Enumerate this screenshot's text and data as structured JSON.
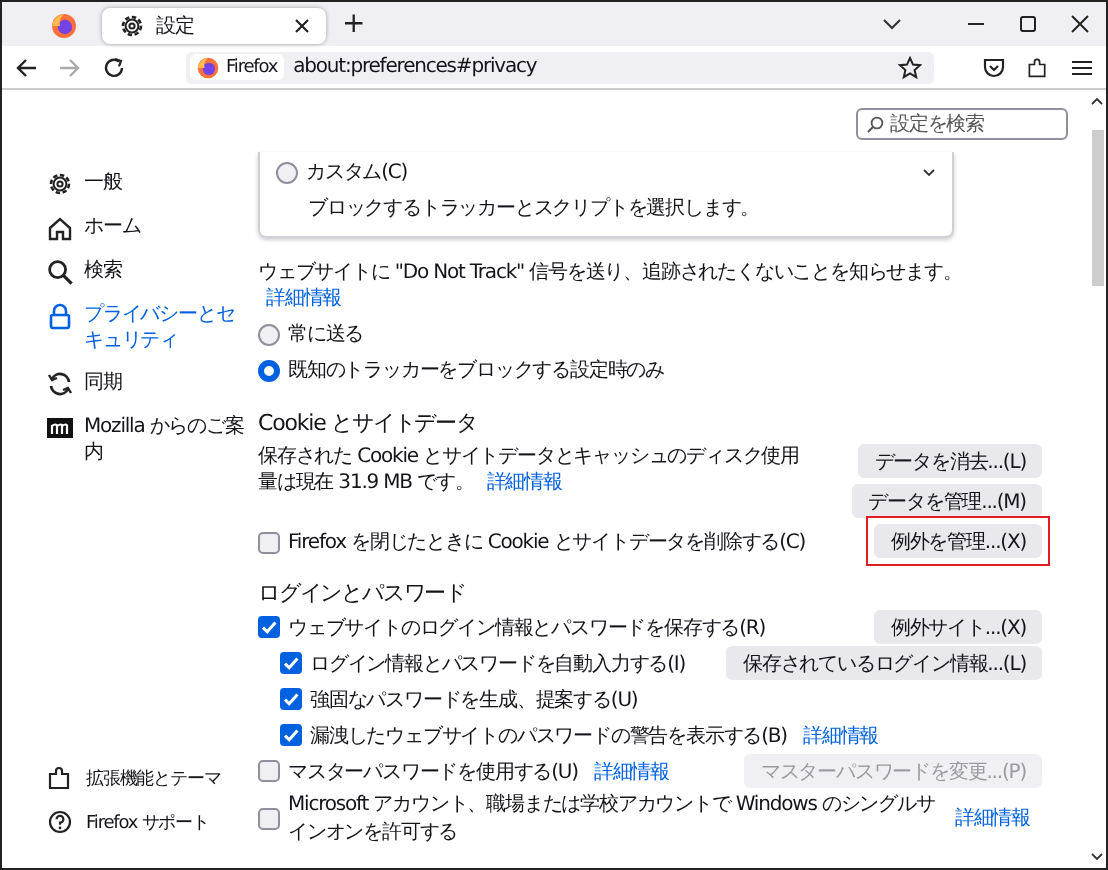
{
  "browser": {
    "tabs": [
      {
        "kind": "pinned",
        "selected": false
      },
      {
        "kind": "page",
        "label": "設定",
        "selected": true
      }
    ],
    "new_tab": "+",
    "address": {
      "identity": "Firefox",
      "url": "about:preferences#privacy"
    }
  },
  "search": {
    "placeholder": "設定を検索"
  },
  "sidebar": {
    "items": [
      {
        "label": "一般",
        "selected": false
      },
      {
        "label": "ホーム",
        "selected": false
      },
      {
        "label": "検索",
        "selected": false
      },
      {
        "label": "プライバシーとセキュリティ",
        "selected": true
      },
      {
        "label": "同期",
        "selected": false
      },
      {
        "label": "Mozilla からのご案内",
        "selected": false
      }
    ],
    "footer": [
      {
        "label": "拡張機能とテーマ"
      },
      {
        "label": "Firefox サポート"
      }
    ]
  },
  "custom_option": {
    "label": "カスタム(C)",
    "description": "ブロックするトラッカーとスクリプトを選択します。",
    "selected": false
  },
  "dnt": {
    "text": "ウェブサイトに \"Do Not Track\" 信号を送り、追跡されたくないことを知らせます。",
    "link": "詳細情報",
    "options": [
      {
        "label": "常に送る",
        "selected": false
      },
      {
        "label": "既知のトラッカーをブロックする設定時のみ",
        "selected": true
      }
    ]
  },
  "cookies": {
    "heading": "Cookie とサイトデータ",
    "description": "保存された Cookie とサイトデータとキャッシュのディスク使用量は現在 31.9 MB です。",
    "link": "詳細情報",
    "buttons": [
      {
        "label": "データを消去...(L)",
        "highlighted": false
      },
      {
        "label": "データを管理...(M)",
        "highlighted": false
      },
      {
        "label": "例外を管理...(X)",
        "highlighted": true
      }
    ],
    "checkbox": {
      "label": "Firefox を閉じたときに Cookie とサイトデータを削除する(C)",
      "checked": false
    }
  },
  "logins": {
    "heading": "ログインとパスワード",
    "items": [
      {
        "label": "ウェブサイトのログイン情報とパスワードを保存する(R)",
        "checked": true,
        "button": {
          "label": "例外サイト...(X)",
          "disabled": false
        },
        "children": [
          {
            "label": "ログイン情報とパスワードを自動入力する(I)",
            "checked": true,
            "button": {
              "label": "保存されているログイン情報...(L)",
              "disabled": false
            }
          },
          {
            "label": "強固なパスワードを生成、提案する(U)",
            "checked": true
          },
          {
            "label": "漏洩したウェブサイトのパスワードの警告を表示する(B)",
            "checked": true,
            "link": "詳細情報"
          }
        ]
      },
      {
        "label": "マスターパスワードを使用する(U)",
        "checked": false,
        "link": "詳細情報",
        "button": {
          "label": "マスターパスワードを変更...(P)",
          "disabled": true
        }
      },
      {
        "label": "Microsoft アカウント、職場または学校アカウントで Windows のシングルサインオンを許可する",
        "checked": false,
        "link": "詳細情報"
      }
    ]
  }
}
